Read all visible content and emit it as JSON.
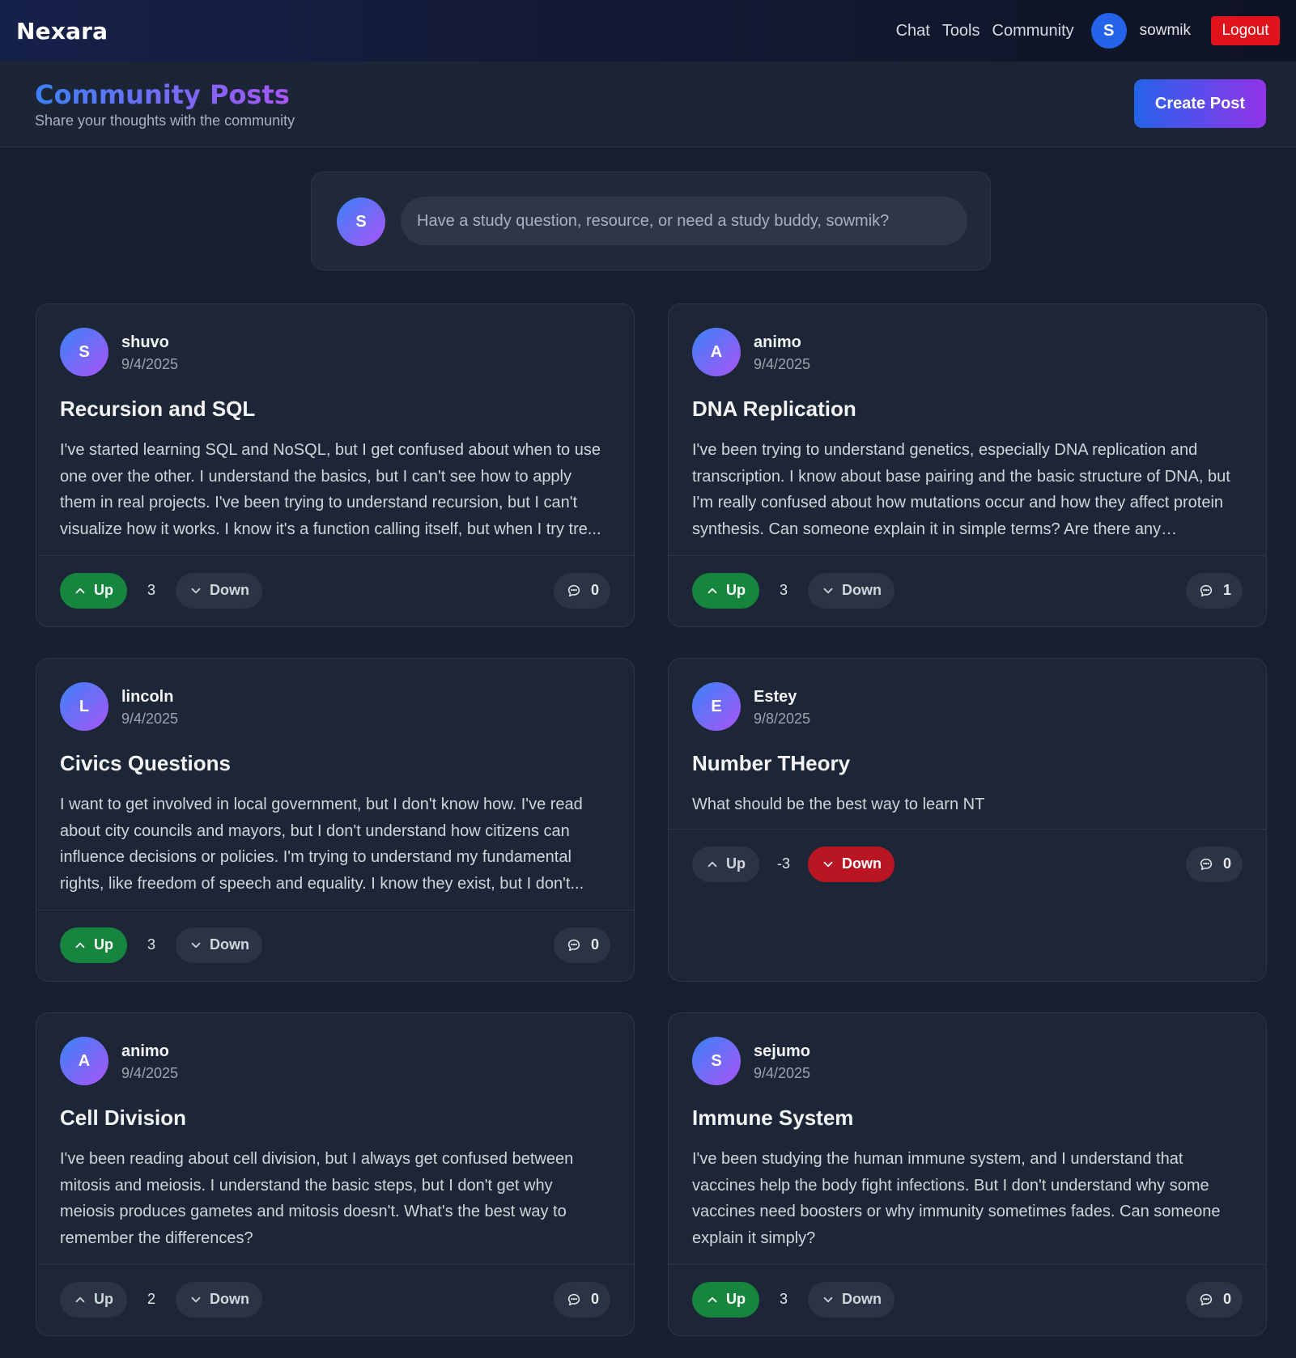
{
  "navbar": {
    "brand": "Nexara",
    "links": [
      "Chat",
      "Tools",
      "Community"
    ],
    "avatar_initial": "S",
    "username": "sowmik",
    "logout_label": "Logout"
  },
  "header": {
    "title": "Community Posts",
    "subtitle": "Share your thoughts with the community",
    "create_label": "Create Post"
  },
  "composer": {
    "avatar_initial": "S",
    "placeholder": "Have a study question, resource, or need a study buddy, sowmik?"
  },
  "labels": {
    "up": "Up",
    "down": "Down"
  },
  "colors": {
    "accent_blue": "#2563eb",
    "accent_purple": "#9333ea",
    "upvote_active": "#16853d",
    "downvote_active": "#b91522",
    "logout": "#e0121b"
  },
  "posts": [
    {
      "initial": "S",
      "author": "shuvo",
      "date": "9/4/2025",
      "title": "Recursion and SQL",
      "body": "I've started learning SQL and NoSQL, but I get confused about when to use one over the other. I understand the basics, but I can't see how to apply them in real projects. I've been trying to understand recursion, but I can't visualize how it works. I know it's a function calling itself, but when I try tre...",
      "votes": "3",
      "vote_state": "up",
      "comments": "0"
    },
    {
      "initial": "A",
      "author": "animo",
      "date": "9/4/2025",
      "title": "DNA Replication",
      "body": "I've been trying to understand genetics, especially DNA replication and transcription. I know about base pairing and the basic structure of DNA, but I'm really confused about how mutations occur and how they affect protein synthesis. Can someone explain it in simple terms? Are there any resources...",
      "votes": "3",
      "vote_state": "up",
      "comments": "1"
    },
    {
      "initial": "L",
      "author": "lincoln",
      "date": "9/4/2025",
      "title": "Civics Questions",
      "body": "I want to get involved in local government, but I don't know how. I've read about city councils and mayors, but I don't understand how citizens can influence decisions or policies. I'm trying to understand my fundamental rights, like freedom of speech and equality. I know they exist, but I don't...",
      "votes": "3",
      "vote_state": "up",
      "comments": "0"
    },
    {
      "initial": "E",
      "author": "Estey",
      "date": "9/8/2025",
      "title": "Number THeory",
      "body": "What should be the best way to learn NT",
      "votes": "-3",
      "vote_state": "down",
      "comments": "0"
    },
    {
      "initial": "A",
      "author": "animo",
      "date": "9/4/2025",
      "title": "Cell Division",
      "body": "I've been reading about cell division, but I always get confused between mitosis and meiosis. I understand the basic steps, but I don't get why meiosis produces gametes and mitosis doesn't. What's the best way to remember the differences?",
      "votes": "2",
      "vote_state": "none",
      "comments": "0"
    },
    {
      "initial": "S",
      "author": "sejumo",
      "date": "9/4/2025",
      "title": "Immune System",
      "body": "I've been studying the human immune system, and I understand that vaccines help the body fight infections. But I don't understand why some vaccines need boosters or why immunity sometimes fades. Can someone explain it simply?",
      "votes": "3",
      "vote_state": "up",
      "comments": "0"
    }
  ]
}
